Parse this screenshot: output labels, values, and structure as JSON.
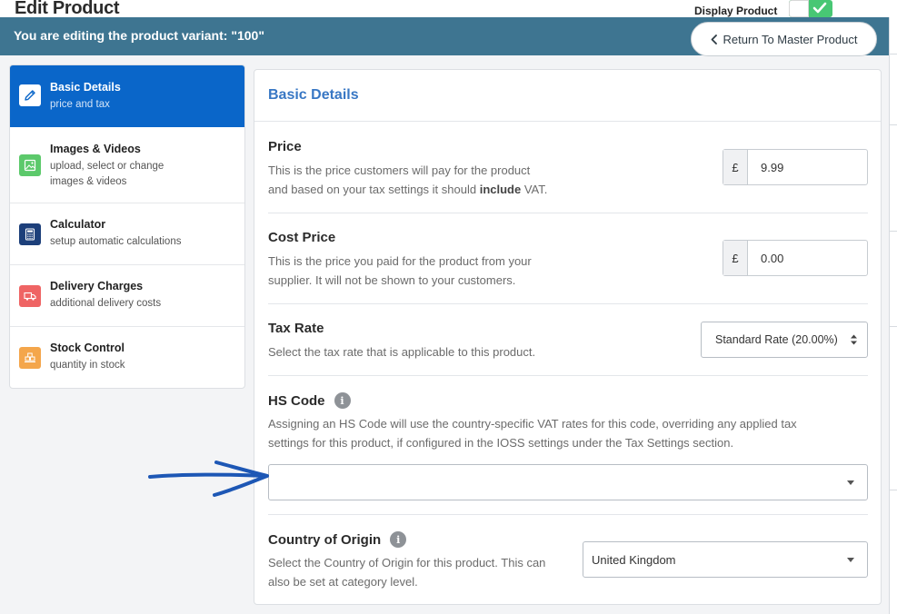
{
  "header": {
    "page_title": "Edit Product",
    "display_label": "Display Product",
    "display_on": true
  },
  "banner": {
    "text": "You are editing the product variant: \"100\"",
    "return_label": "Return To Master Product"
  },
  "sidebar": {
    "items": [
      {
        "title": "Basic Details",
        "subtitle": "price and tax",
        "icon": "pencil-icon",
        "color": "#ffffff",
        "active": true
      },
      {
        "title": "Images & Videos",
        "subtitle": "upload, select or change images & videos",
        "icon": "image-icon",
        "color": "#5cc96b",
        "active": false
      },
      {
        "title": "Calculator",
        "subtitle": "setup automatic calculations",
        "icon": "calculator-icon",
        "color": "#1c3f7a",
        "active": false
      },
      {
        "title": "Delivery Charges",
        "subtitle": "additional delivery costs",
        "icon": "truck-icon",
        "color": "#ef6464",
        "active": false
      },
      {
        "title": "Stock Control",
        "subtitle": "quantity in stock",
        "icon": "boxes-icon",
        "color": "#f4a64b",
        "active": false
      }
    ]
  },
  "panel": {
    "title": "Basic Details",
    "price": {
      "label": "Price",
      "desc_line1": "This is the price customers will pay for the product",
      "desc_line2_pre": "and based on your tax settings it should ",
      "desc_line2_bold": "include",
      "desc_line2_post": " VAT.",
      "currency": "£",
      "value": "9.99"
    },
    "cost_price": {
      "label": "Cost Price",
      "desc_line1": "This is the price you paid for the product from your",
      "desc_line2": "supplier. It will not be shown to your customers.",
      "currency": "£",
      "value": "0.00"
    },
    "tax_rate": {
      "label": "Tax Rate",
      "desc": "Select the tax rate that is applicable to this product.",
      "selected": "Standard Rate (20.00%)"
    },
    "hs_code": {
      "label": "HS Code",
      "info": "i",
      "desc_line1": "Assigning an HS Code will use the country-specific VAT rates for this code, overriding any applied tax",
      "desc_line2": "settings for this product, if configured in the IOSS settings under the Tax Settings section.",
      "selected": ""
    },
    "country": {
      "label": "Country of Origin",
      "info": "i",
      "desc_line1": "Select the Country of Origin for this product. This can",
      "desc_line2": "also be set at category level.",
      "selected": "United Kingdom"
    }
  },
  "colors": {
    "banner": "#3e7591",
    "active_nav": "#0a66c9",
    "panel_title": "#3877c4",
    "toggle_on": "#48c774",
    "annotation_arrow": "#1d57b5"
  }
}
